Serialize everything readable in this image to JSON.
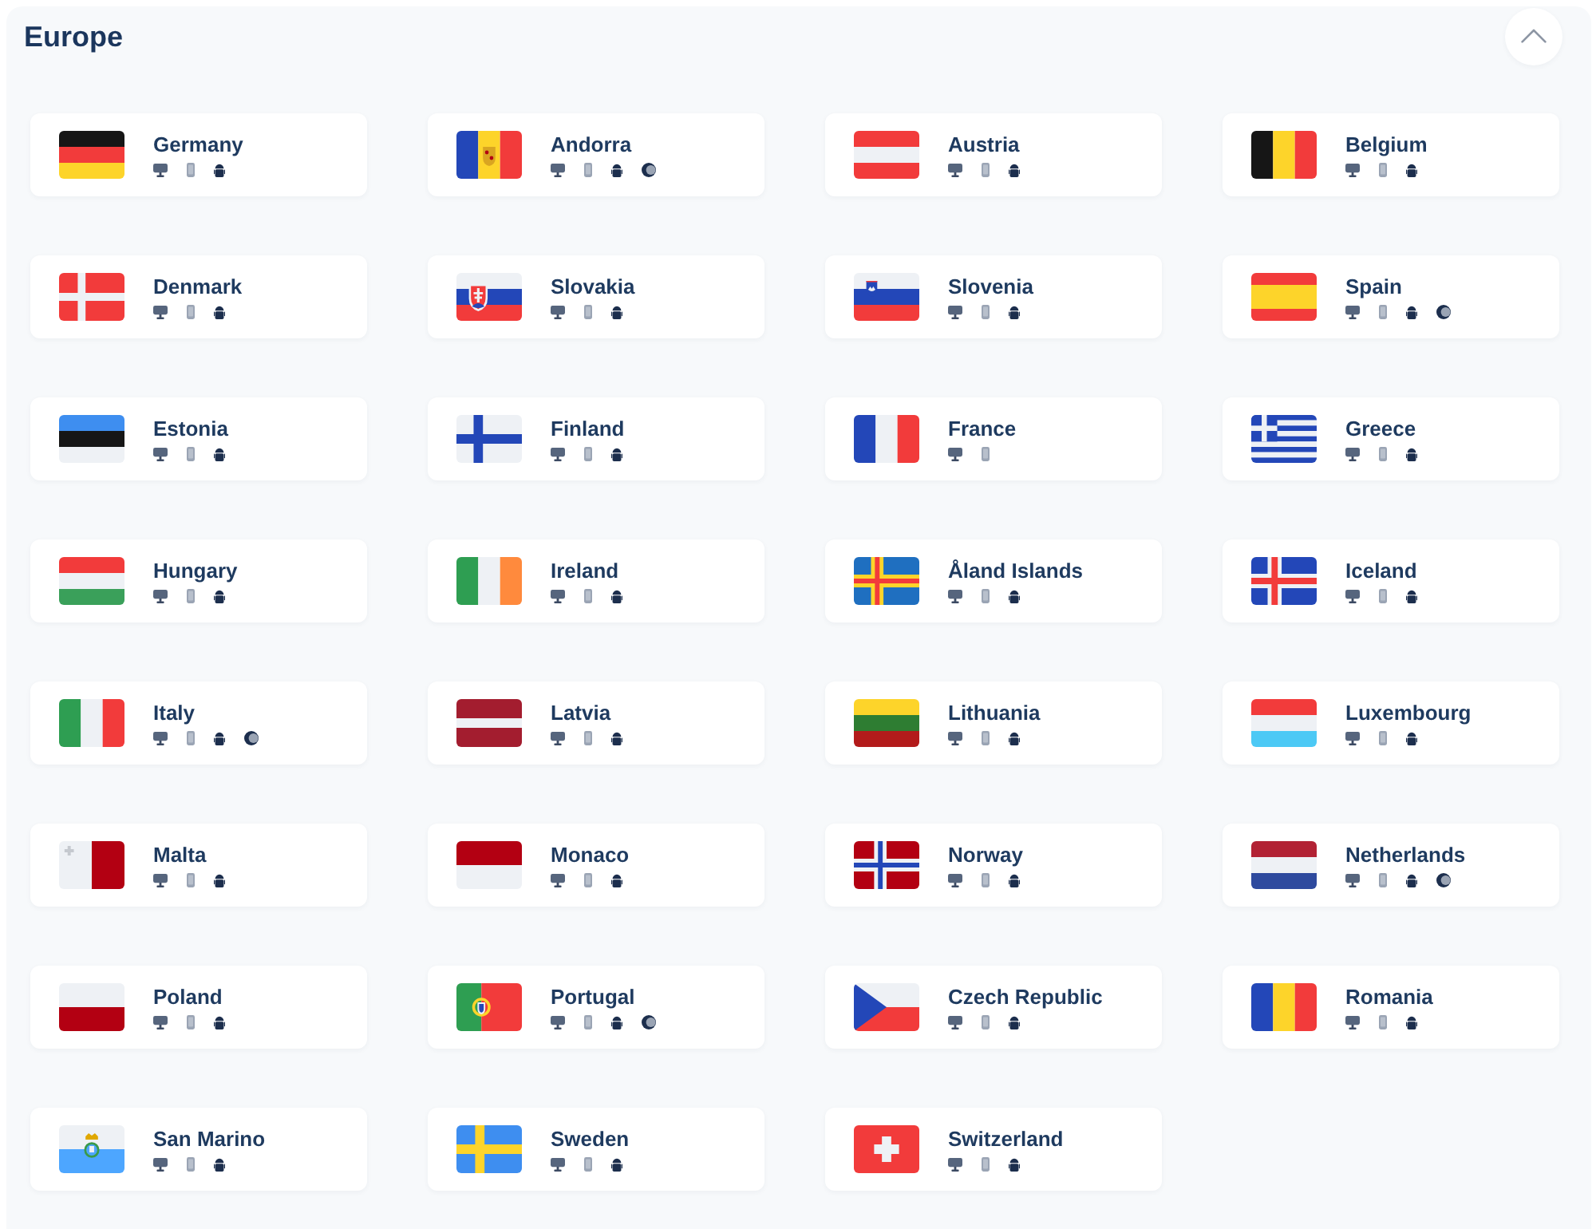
{
  "section": {
    "title": "Europe",
    "expanded": true,
    "countries": [
      {
        "name": "Germany",
        "kind": "de",
        "platforms": [
          {
            "kind": "monitor"
          },
          {
            "kind": "phone"
          },
          {
            "kind": "robot"
          }
        ]
      },
      {
        "name": "Andorra",
        "kind": "ad",
        "platforms": [
          {
            "kind": "monitor"
          },
          {
            "kind": "phone"
          },
          {
            "kind": "robot"
          },
          {
            "kind": "crescent"
          }
        ]
      },
      {
        "name": "Austria",
        "kind": "at",
        "platforms": [
          {
            "kind": "monitor"
          },
          {
            "kind": "phone"
          },
          {
            "kind": "robot"
          }
        ]
      },
      {
        "name": "Belgium",
        "kind": "be",
        "platforms": [
          {
            "kind": "monitor"
          },
          {
            "kind": "phone"
          },
          {
            "kind": "robot"
          }
        ]
      },
      {
        "name": "Denmark",
        "kind": "dk",
        "platforms": [
          {
            "kind": "monitor"
          },
          {
            "kind": "phone"
          },
          {
            "kind": "robot"
          }
        ]
      },
      {
        "name": "Slovakia",
        "kind": "sk",
        "platforms": [
          {
            "kind": "monitor"
          },
          {
            "kind": "phone"
          },
          {
            "kind": "robot"
          }
        ]
      },
      {
        "name": "Slovenia",
        "kind": "si",
        "platforms": [
          {
            "kind": "monitor"
          },
          {
            "kind": "phone"
          },
          {
            "kind": "robot"
          }
        ]
      },
      {
        "name": "Spain",
        "kind": "es",
        "platforms": [
          {
            "kind": "monitor"
          },
          {
            "kind": "phone"
          },
          {
            "kind": "robot"
          },
          {
            "kind": "crescent"
          }
        ]
      },
      {
        "name": "Estonia",
        "kind": "ee",
        "platforms": [
          {
            "kind": "monitor"
          },
          {
            "kind": "phone"
          },
          {
            "kind": "robot"
          }
        ]
      },
      {
        "name": "Finland",
        "kind": "fi",
        "platforms": [
          {
            "kind": "monitor"
          },
          {
            "kind": "phone"
          },
          {
            "kind": "robot"
          }
        ]
      },
      {
        "name": "France",
        "kind": "fr",
        "platforms": [
          {
            "kind": "monitor"
          },
          {
            "kind": "phone"
          }
        ]
      },
      {
        "name": "Greece",
        "kind": "gr",
        "platforms": [
          {
            "kind": "monitor"
          },
          {
            "kind": "phone"
          },
          {
            "kind": "robot"
          }
        ]
      },
      {
        "name": "Hungary",
        "kind": "hu",
        "platforms": [
          {
            "kind": "monitor"
          },
          {
            "kind": "phone"
          },
          {
            "kind": "robot"
          }
        ]
      },
      {
        "name": "Ireland",
        "kind": "ie",
        "platforms": [
          {
            "kind": "monitor"
          },
          {
            "kind": "phone"
          },
          {
            "kind": "robot"
          }
        ]
      },
      {
        "name": "Åland Islands",
        "kind": "ax",
        "platforms": [
          {
            "kind": "monitor"
          },
          {
            "kind": "phone"
          },
          {
            "kind": "robot"
          }
        ]
      },
      {
        "name": "Iceland",
        "kind": "is",
        "platforms": [
          {
            "kind": "monitor"
          },
          {
            "kind": "phone"
          },
          {
            "kind": "robot"
          }
        ]
      },
      {
        "name": "Italy",
        "kind": "it",
        "platforms": [
          {
            "kind": "monitor"
          },
          {
            "kind": "phone"
          },
          {
            "kind": "robot"
          },
          {
            "kind": "crescent"
          }
        ]
      },
      {
        "name": "Latvia",
        "kind": "lv",
        "platforms": [
          {
            "kind": "monitor"
          },
          {
            "kind": "phone"
          },
          {
            "kind": "robot"
          }
        ]
      },
      {
        "name": "Lithuania",
        "kind": "lt",
        "platforms": [
          {
            "kind": "monitor"
          },
          {
            "kind": "phone"
          },
          {
            "kind": "robot"
          }
        ]
      },
      {
        "name": "Luxembourg",
        "kind": "lu",
        "platforms": [
          {
            "kind": "monitor"
          },
          {
            "kind": "phone"
          },
          {
            "kind": "robot"
          }
        ]
      },
      {
        "name": "Malta",
        "kind": "mt",
        "platforms": [
          {
            "kind": "monitor"
          },
          {
            "kind": "phone"
          },
          {
            "kind": "robot"
          }
        ]
      },
      {
        "name": "Monaco",
        "kind": "mc",
        "platforms": [
          {
            "kind": "monitor"
          },
          {
            "kind": "phone"
          },
          {
            "kind": "robot"
          }
        ]
      },
      {
        "name": "Norway",
        "kind": "no",
        "platforms": [
          {
            "kind": "monitor"
          },
          {
            "kind": "phone"
          },
          {
            "kind": "robot"
          }
        ]
      },
      {
        "name": "Netherlands",
        "kind": "nl",
        "platforms": [
          {
            "kind": "monitor"
          },
          {
            "kind": "phone"
          },
          {
            "kind": "robot"
          },
          {
            "kind": "crescent"
          }
        ]
      },
      {
        "name": "Poland",
        "kind": "pl",
        "platforms": [
          {
            "kind": "monitor"
          },
          {
            "kind": "phone"
          },
          {
            "kind": "robot"
          }
        ]
      },
      {
        "name": "Portugal",
        "kind": "pt",
        "platforms": [
          {
            "kind": "monitor"
          },
          {
            "kind": "phone"
          },
          {
            "kind": "robot"
          },
          {
            "kind": "crescent"
          }
        ]
      },
      {
        "name": "Czech Republic",
        "kind": "cz",
        "platforms": [
          {
            "kind": "monitor"
          },
          {
            "kind": "phone"
          },
          {
            "kind": "robot"
          }
        ]
      },
      {
        "name": "Romania",
        "kind": "ro",
        "platforms": [
          {
            "kind": "monitor"
          },
          {
            "kind": "phone"
          },
          {
            "kind": "robot"
          }
        ]
      },
      {
        "name": "San Marino",
        "kind": "sm",
        "platforms": [
          {
            "kind": "monitor"
          },
          {
            "kind": "phone"
          },
          {
            "kind": "robot"
          }
        ]
      },
      {
        "name": "Sweden",
        "kind": "se",
        "platforms": [
          {
            "kind": "monitor"
          },
          {
            "kind": "phone"
          },
          {
            "kind": "robot"
          }
        ]
      },
      {
        "name": "Switzerland",
        "kind": "ch",
        "platforms": [
          {
            "kind": "monitor"
          },
          {
            "kind": "phone"
          },
          {
            "kind": "robot"
          }
        ]
      }
    ]
  }
}
